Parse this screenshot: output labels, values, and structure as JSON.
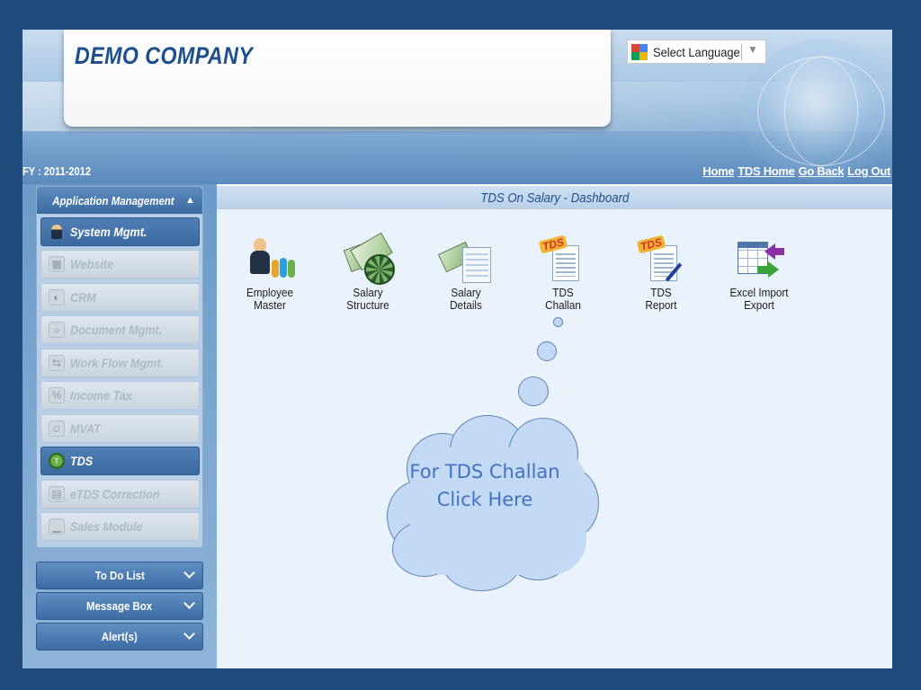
{
  "header": {
    "company": "DEMO COMPANY",
    "language_select": "Select Language",
    "fy": "FY : 2011-2012",
    "links": [
      "Home",
      "TDS Home",
      "Go Back",
      "Log Out"
    ]
  },
  "sidebar": {
    "section_title": "Application Management",
    "items": [
      {
        "label": "System Mgmt.",
        "active": true
      },
      {
        "label": "Website",
        "active": false
      },
      {
        "label": "CRM",
        "active": false
      },
      {
        "label": "Document Mgmt.",
        "active": false
      },
      {
        "label": "Work Flow Mgmt.",
        "active": false
      },
      {
        "label": "Income Tax",
        "active": false
      },
      {
        "label": "MVAT",
        "active": false
      },
      {
        "label": "TDS",
        "active": true
      },
      {
        "label": "eTDS Correction",
        "active": false
      },
      {
        "label": "Sales Module",
        "active": false
      }
    ],
    "panels": [
      "To Do List",
      "Message Box",
      "Alert(s)"
    ]
  },
  "main": {
    "title": "TDS On Salary - Dashboard",
    "tiles": [
      {
        "label": "Employee\nMaster",
        "icon": "employee-master-icon"
      },
      {
        "label": "Salary\nStructure",
        "icon": "salary-structure-icon"
      },
      {
        "label": "Salary\nDetails",
        "icon": "salary-details-icon"
      },
      {
        "label": "TDS\nChallan",
        "icon": "tds-challan-icon"
      },
      {
        "label": "TDS\nReport",
        "icon": "tds-report-icon"
      },
      {
        "label": "Excel Import\nExport",
        "icon": "excel-import-export-icon"
      }
    ]
  },
  "callout": {
    "text": "For TDS Challan Click Here"
  }
}
